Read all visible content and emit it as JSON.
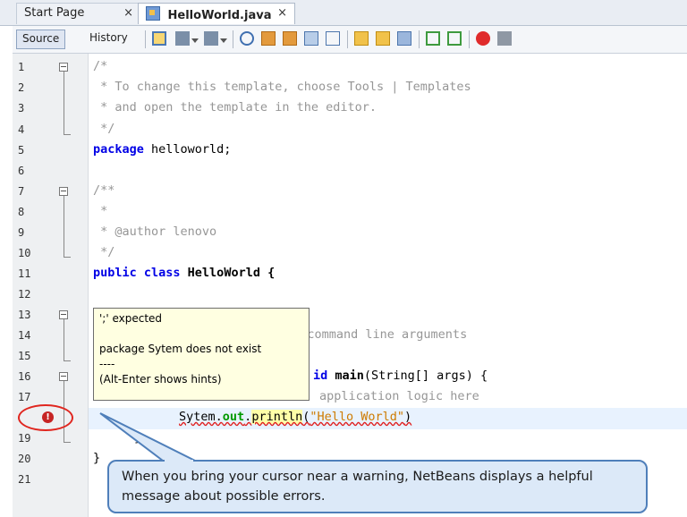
{
  "tabs": [
    {
      "label": "Start Page",
      "close": "×"
    },
    {
      "label": "HelloWorld.java",
      "close": "×"
    }
  ],
  "toolbar": {
    "source_label": "Source",
    "history_label": "History"
  },
  "line_numbers": [
    "1",
    "2",
    "3",
    "4",
    "5",
    "6",
    "7",
    "8",
    "9",
    "10",
    "11",
    "12",
    "13",
    "14",
    "15",
    "16",
    "17",
    "",
    "19",
    "20",
    "21"
  ],
  "code": {
    "l1": "/*",
    "l2": " * To change this template, choose Tools | Templates",
    "l3": " * and open the template in the editor.",
    "l4": " */",
    "l5_kw": "package",
    "l5_rest": " helloworld;",
    "l7": "/**",
    "l8": " *",
    "l9": " * @author lenovo",
    "l10": " */",
    "l11_kw": "public class",
    "l11_rest": " HelloWorld {",
    "l14": "he command line arguments",
    "l16_kw": "id",
    "l16_mth": " main",
    "l16_rest": "(String[] args) {",
    "l17": "application logic here",
    "l18_a": "Sytem.",
    "l18_b": "out",
    "l18_c": ".",
    "l18_d": "println",
    "l18_e": "(",
    "l18_str": "\"Hello World\"",
    "l18_f": ")",
    "l19": "}",
    "l20": "}"
  },
  "tooltip": {
    "line1": "';' expected",
    "line2": "package Sytem does not exist",
    "line3": "----",
    "line4": "(Alt-Enter shows hints)"
  },
  "error_icon": {
    "glyph": "!"
  },
  "callout": {
    "text": "When you bring your cursor near a warning, NetBeans displays a helpful message about possible errors."
  },
  "colors": {
    "keyword": "#0000e6",
    "comment": "#969696",
    "string": "#ce7b00",
    "field": "#009900",
    "error": "#e0261f"
  }
}
